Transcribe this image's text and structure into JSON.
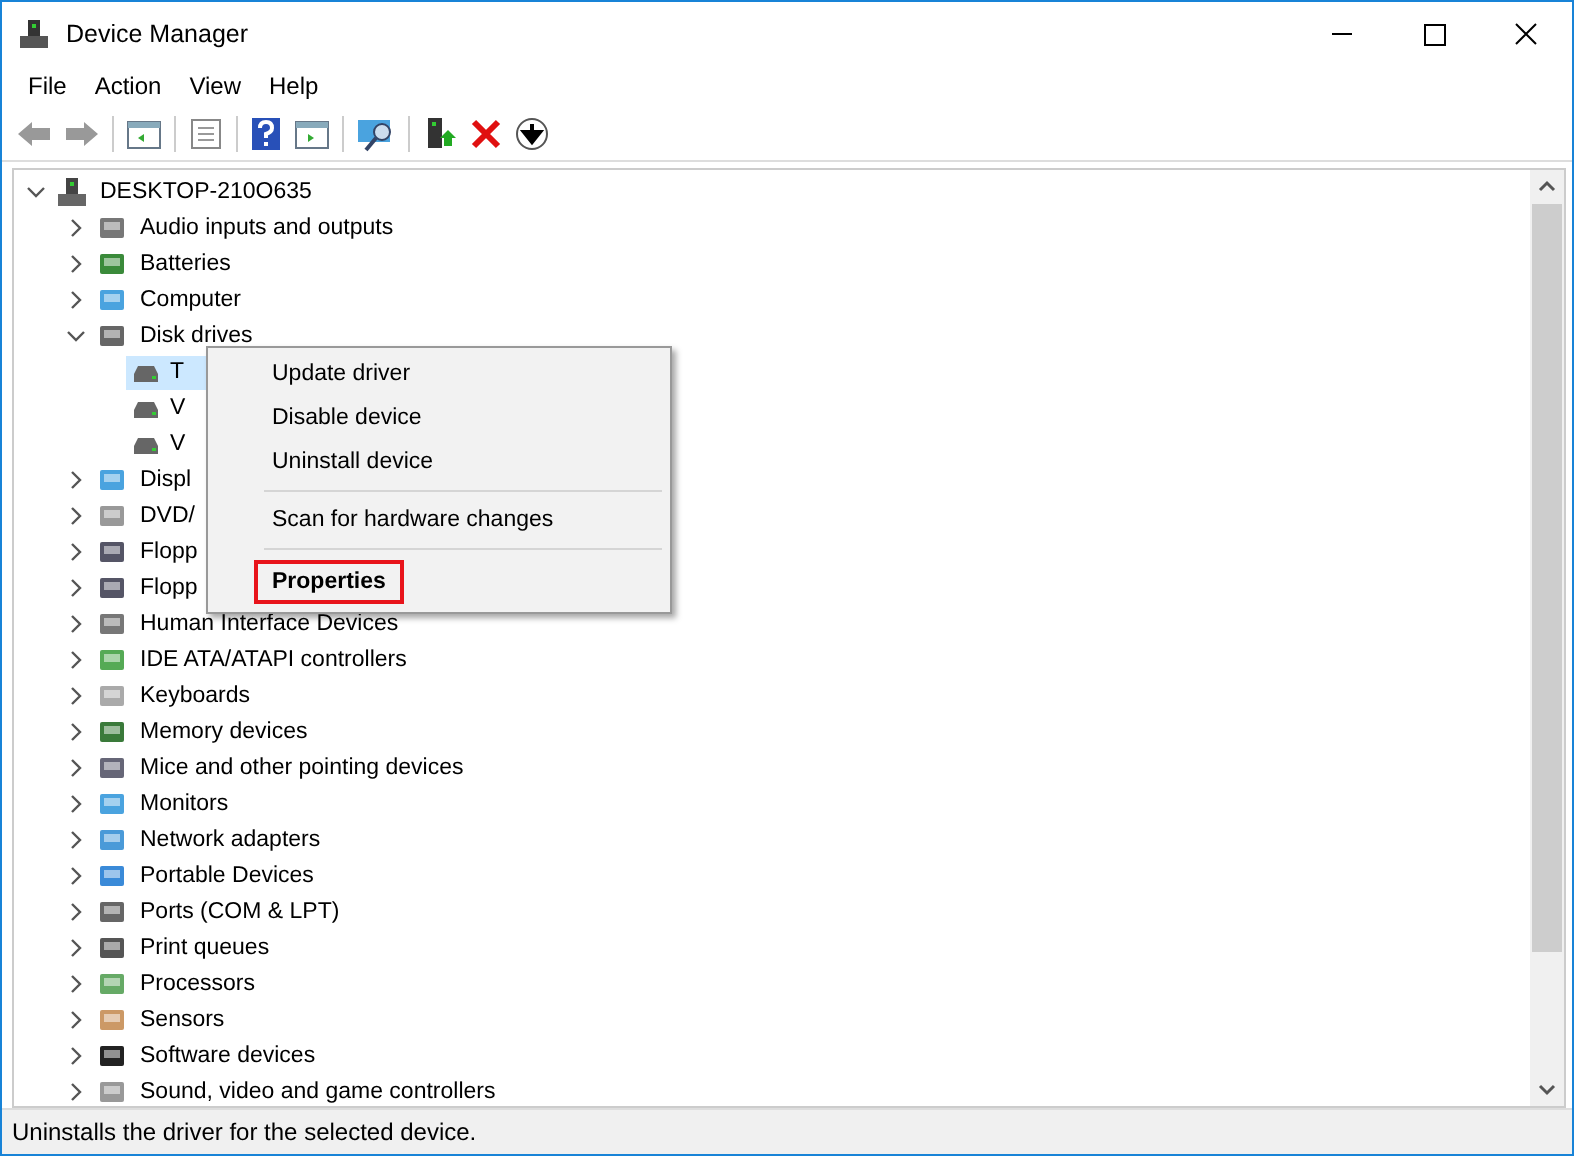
{
  "window": {
    "title": "Device Manager"
  },
  "menu": [
    "File",
    "Action",
    "View",
    "Help"
  ],
  "tree": {
    "label": "DESKTOP-210O635",
    "expanded": true,
    "children": [
      {
        "label": "Audio inputs and outputs",
        "expanded": false
      },
      {
        "label": "Batteries",
        "expanded": false
      },
      {
        "label": "Computer",
        "expanded": false
      },
      {
        "label": "Disk drives",
        "expanded": true,
        "children": [
          {
            "label": "T",
            "selected": true
          },
          {
            "label": "V",
            "selected": false
          },
          {
            "label": "V",
            "selected": false
          }
        ]
      },
      {
        "label": "Displ",
        "expanded": false
      },
      {
        "label": "DVD/",
        "expanded": false
      },
      {
        "label": "Flopp",
        "expanded": false
      },
      {
        "label": "Flopp",
        "expanded": false
      },
      {
        "label": "Human Interface Devices",
        "expanded": false
      },
      {
        "label": "IDE ATA/ATAPI controllers",
        "expanded": false
      },
      {
        "label": "Keyboards",
        "expanded": false
      },
      {
        "label": "Memory devices",
        "expanded": false
      },
      {
        "label": "Mice and other pointing devices",
        "expanded": false
      },
      {
        "label": "Monitors",
        "expanded": false
      },
      {
        "label": "Network adapters",
        "expanded": false
      },
      {
        "label": "Portable Devices",
        "expanded": false
      },
      {
        "label": "Ports (COM & LPT)",
        "expanded": false
      },
      {
        "label": "Print queues",
        "expanded": false
      },
      {
        "label": "Processors",
        "expanded": false
      },
      {
        "label": "Sensors",
        "expanded": false
      },
      {
        "label": "Software devices",
        "expanded": false
      },
      {
        "label": "Sound, video and game controllers",
        "expanded": false
      }
    ]
  },
  "context_menu": [
    {
      "label": "Update driver",
      "selected": false
    },
    {
      "label": "Disable device",
      "selected": false
    },
    {
      "label": "Uninstall device",
      "selected": false
    },
    {
      "kind": "separator"
    },
    {
      "label": "Scan for hardware changes",
      "selected": false
    },
    {
      "kind": "separator"
    },
    {
      "label": "Properties",
      "selected": true
    }
  ],
  "status_bar": "Uninstalls the driver for the selected device."
}
